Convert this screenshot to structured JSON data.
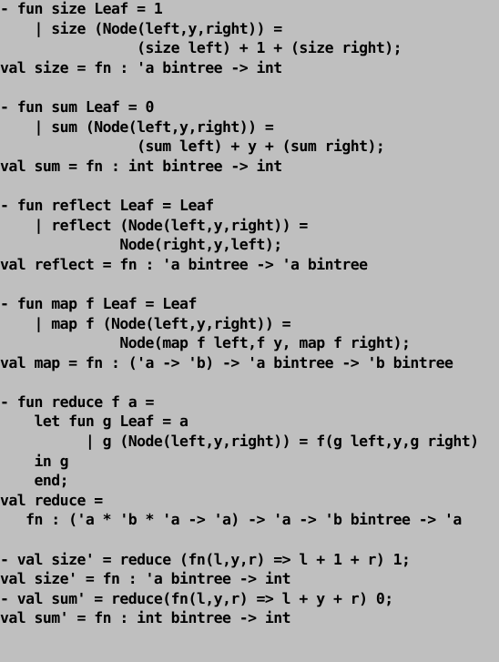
{
  "terminal": {
    "background_color": "#bfbfbf",
    "foreground_color": "#000000",
    "prompt_symbol": "-",
    "lines": [
      "- fun size Leaf = 1",
      "    | size (Node(left,y,right)) =",
      "                (size left) + 1 + (size right);",
      "val size = fn : 'a bintree -> int",
      "",
      "- fun sum Leaf = 0",
      "    | sum (Node(left,y,right)) =",
      "                (sum left) + y + (sum right);",
      "val sum = fn : int bintree -> int",
      "",
      "- fun reflect Leaf = Leaf",
      "    | reflect (Node(left,y,right)) =",
      "              Node(right,y,left);",
      "val reflect = fn : 'a bintree -> 'a bintree",
      "",
      "- fun map f Leaf = Leaf",
      "    | map f (Node(left,y,right)) =",
      "              Node(map f left,f y, map f right);",
      "val map = fn : ('a -> 'b) -> 'a bintree -> 'b bintree",
      "",
      "- fun reduce f a =",
      "    let fun g Leaf = a",
      "          | g (Node(left,y,right)) = f(g left,y,g right)",
      "    in g",
      "    end;",
      "val reduce =",
      "   fn : ('a * 'b * 'a -> 'a) -> 'a -> 'b bintree -> 'a",
      "",
      "- val size' = reduce (fn(l,y,r) => l + 1 + r) 1;",
      "val size' = fn : 'a bintree -> int",
      "- val sum' = reduce(fn(l,y,r) => l + y + r) 0;",
      "val sum' = fn : int bintree -> int"
    ]
  }
}
